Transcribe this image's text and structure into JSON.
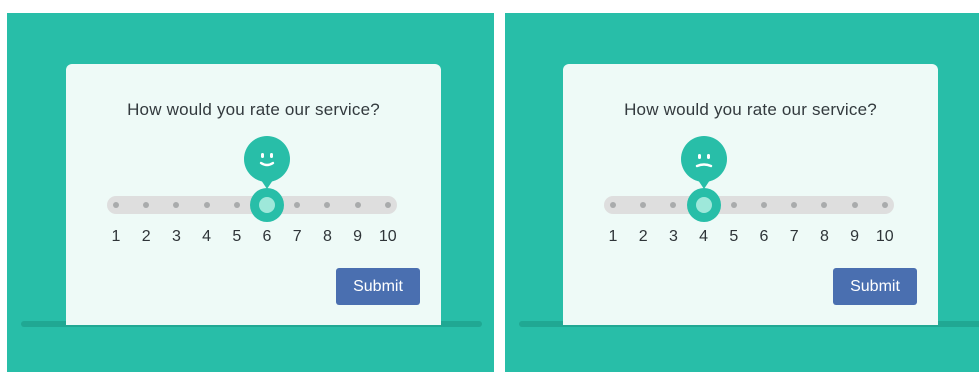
{
  "colors": {
    "accent": "#28bea8",
    "card": "#eefaf7",
    "track": "#dedede",
    "button": "#4a6fb0"
  },
  "widgets": [
    {
      "question": "How would you rate our service?",
      "scale": [
        "1",
        "2",
        "3",
        "4",
        "5",
        "6",
        "7",
        "8",
        "9",
        "10"
      ],
      "selected_value": 6,
      "face_icon": "smile-face-icon",
      "submit_label": "Submit"
    },
    {
      "question": "How would you rate our service?",
      "scale": [
        "1",
        "2",
        "3",
        "4",
        "5",
        "6",
        "7",
        "8",
        "9",
        "10"
      ],
      "selected_value": 4,
      "face_icon": "neutral-face-icon",
      "submit_label": "Submit"
    }
  ]
}
